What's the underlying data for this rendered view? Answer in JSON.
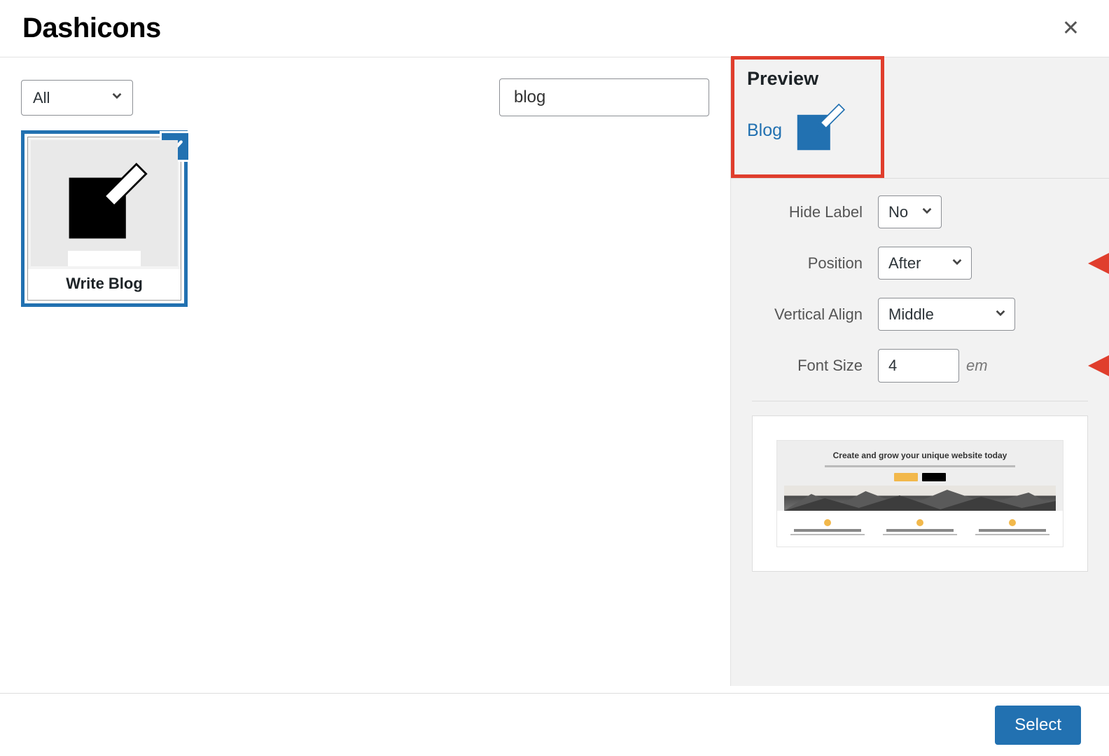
{
  "header": {
    "title": "Dashicons"
  },
  "filter": {
    "category": "All",
    "search_value": "blog"
  },
  "grid": {
    "items": [
      {
        "label": "Write Blog",
        "icon": "write-blog"
      }
    ]
  },
  "preview": {
    "heading": "Preview",
    "label_text": "Blog"
  },
  "settings": {
    "hide_label": {
      "label": "Hide Label",
      "value": "No"
    },
    "position": {
      "label": "Position",
      "value": "After"
    },
    "vertical_align": {
      "label": "Vertical Align",
      "value": "Middle"
    },
    "font_size": {
      "label": "Font Size",
      "value": "4",
      "unit": "em"
    }
  },
  "promo": {
    "banner_title": "Create and grow your unique website today"
  },
  "footer": {
    "select_label": "Select"
  }
}
